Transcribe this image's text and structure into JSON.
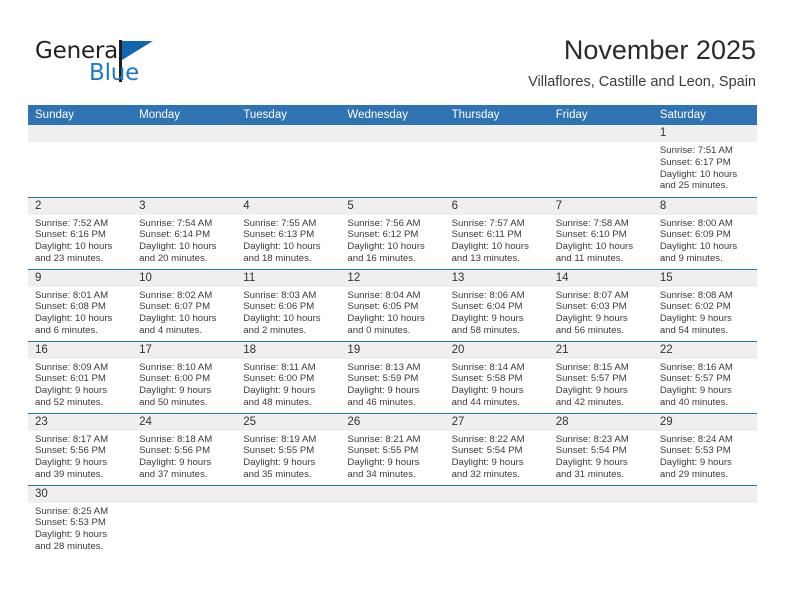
{
  "brand": {
    "name_top": "General",
    "name_bottom": "Blue",
    "flag_color": "#1266ae",
    "text_color": "#231f20",
    "blue_text_color": "#1f7ac4"
  },
  "header": {
    "title": "November 2025",
    "subtitle": "Villaflores, Castille and Leon, Spain"
  },
  "theme": {
    "header_blue": "#2f73b3",
    "daynum_band": "#efefef",
    "grid_line": "#2f73b3"
  },
  "calendar": {
    "weekday_headers": [
      "Sunday",
      "Monday",
      "Tuesday",
      "Wednesday",
      "Thursday",
      "Friday",
      "Saturday"
    ],
    "weeks": [
      [
        {
          "day": "",
          "lines": []
        },
        {
          "day": "",
          "lines": []
        },
        {
          "day": "",
          "lines": []
        },
        {
          "day": "",
          "lines": []
        },
        {
          "day": "",
          "lines": []
        },
        {
          "day": "",
          "lines": []
        },
        {
          "day": "1",
          "lines": [
            "Sunrise: 7:51 AM",
            "Sunset: 6:17 PM",
            "Daylight: 10 hours",
            "and 25 minutes."
          ]
        }
      ],
      [
        {
          "day": "2",
          "lines": [
            "Sunrise: 7:52 AM",
            "Sunset: 6:16 PM",
            "Daylight: 10 hours",
            "and 23 minutes."
          ]
        },
        {
          "day": "3",
          "lines": [
            "Sunrise: 7:54 AM",
            "Sunset: 6:14 PM",
            "Daylight: 10 hours",
            "and 20 minutes."
          ]
        },
        {
          "day": "4",
          "lines": [
            "Sunrise: 7:55 AM",
            "Sunset: 6:13 PM",
            "Daylight: 10 hours",
            "and 18 minutes."
          ]
        },
        {
          "day": "5",
          "lines": [
            "Sunrise: 7:56 AM",
            "Sunset: 6:12 PM",
            "Daylight: 10 hours",
            "and 16 minutes."
          ]
        },
        {
          "day": "6",
          "lines": [
            "Sunrise: 7:57 AM",
            "Sunset: 6:11 PM",
            "Daylight: 10 hours",
            "and 13 minutes."
          ]
        },
        {
          "day": "7",
          "lines": [
            "Sunrise: 7:58 AM",
            "Sunset: 6:10 PM",
            "Daylight: 10 hours",
            "and 11 minutes."
          ]
        },
        {
          "day": "8",
          "lines": [
            "Sunrise: 8:00 AM",
            "Sunset: 6:09 PM",
            "Daylight: 10 hours",
            "and 9 minutes."
          ]
        }
      ],
      [
        {
          "day": "9",
          "lines": [
            "Sunrise: 8:01 AM",
            "Sunset: 6:08 PM",
            "Daylight: 10 hours",
            "and 6 minutes."
          ]
        },
        {
          "day": "10",
          "lines": [
            "Sunrise: 8:02 AM",
            "Sunset: 6:07 PM",
            "Daylight: 10 hours",
            "and 4 minutes."
          ]
        },
        {
          "day": "11",
          "lines": [
            "Sunrise: 8:03 AM",
            "Sunset: 6:06 PM",
            "Daylight: 10 hours",
            "and 2 minutes."
          ]
        },
        {
          "day": "12",
          "lines": [
            "Sunrise: 8:04 AM",
            "Sunset: 6:05 PM",
            "Daylight: 10 hours",
            "and 0 minutes."
          ]
        },
        {
          "day": "13",
          "lines": [
            "Sunrise: 8:06 AM",
            "Sunset: 6:04 PM",
            "Daylight: 9 hours",
            "and 58 minutes."
          ]
        },
        {
          "day": "14",
          "lines": [
            "Sunrise: 8:07 AM",
            "Sunset: 6:03 PM",
            "Daylight: 9 hours",
            "and 56 minutes."
          ]
        },
        {
          "day": "15",
          "lines": [
            "Sunrise: 8:08 AM",
            "Sunset: 6:02 PM",
            "Daylight: 9 hours",
            "and 54 minutes."
          ]
        }
      ],
      [
        {
          "day": "16",
          "lines": [
            "Sunrise: 8:09 AM",
            "Sunset: 6:01 PM",
            "Daylight: 9 hours",
            "and 52 minutes."
          ]
        },
        {
          "day": "17",
          "lines": [
            "Sunrise: 8:10 AM",
            "Sunset: 6:00 PM",
            "Daylight: 9 hours",
            "and 50 minutes."
          ]
        },
        {
          "day": "18",
          "lines": [
            "Sunrise: 8:11 AM",
            "Sunset: 6:00 PM",
            "Daylight: 9 hours",
            "and 48 minutes."
          ]
        },
        {
          "day": "19",
          "lines": [
            "Sunrise: 8:13 AM",
            "Sunset: 5:59 PM",
            "Daylight: 9 hours",
            "and 46 minutes."
          ]
        },
        {
          "day": "20",
          "lines": [
            "Sunrise: 8:14 AM",
            "Sunset: 5:58 PM",
            "Daylight: 9 hours",
            "and 44 minutes."
          ]
        },
        {
          "day": "21",
          "lines": [
            "Sunrise: 8:15 AM",
            "Sunset: 5:57 PM",
            "Daylight: 9 hours",
            "and 42 minutes."
          ]
        },
        {
          "day": "22",
          "lines": [
            "Sunrise: 8:16 AM",
            "Sunset: 5:57 PM",
            "Daylight: 9 hours",
            "and 40 minutes."
          ]
        }
      ],
      [
        {
          "day": "23",
          "lines": [
            "Sunrise: 8:17 AM",
            "Sunset: 5:56 PM",
            "Daylight: 9 hours",
            "and 39 minutes."
          ]
        },
        {
          "day": "24",
          "lines": [
            "Sunrise: 8:18 AM",
            "Sunset: 5:56 PM",
            "Daylight: 9 hours",
            "and 37 minutes."
          ]
        },
        {
          "day": "25",
          "lines": [
            "Sunrise: 8:19 AM",
            "Sunset: 5:55 PM",
            "Daylight: 9 hours",
            "and 35 minutes."
          ]
        },
        {
          "day": "26",
          "lines": [
            "Sunrise: 8:21 AM",
            "Sunset: 5:55 PM",
            "Daylight: 9 hours",
            "and 34 minutes."
          ]
        },
        {
          "day": "27",
          "lines": [
            "Sunrise: 8:22 AM",
            "Sunset: 5:54 PM",
            "Daylight: 9 hours",
            "and 32 minutes."
          ]
        },
        {
          "day": "28",
          "lines": [
            "Sunrise: 8:23 AM",
            "Sunset: 5:54 PM",
            "Daylight: 9 hours",
            "and 31 minutes."
          ]
        },
        {
          "day": "29",
          "lines": [
            "Sunrise: 8:24 AM",
            "Sunset: 5:53 PM",
            "Daylight: 9 hours",
            "and 29 minutes."
          ]
        }
      ],
      [
        {
          "day": "30",
          "lines": [
            "Sunrise: 8:25 AM",
            "Sunset: 5:53 PM",
            "Daylight: 9 hours",
            "and 28 minutes."
          ]
        },
        {
          "day": "",
          "lines": []
        },
        {
          "day": "",
          "lines": []
        },
        {
          "day": "",
          "lines": []
        },
        {
          "day": "",
          "lines": []
        },
        {
          "day": "",
          "lines": []
        },
        {
          "day": "",
          "lines": []
        }
      ]
    ]
  }
}
